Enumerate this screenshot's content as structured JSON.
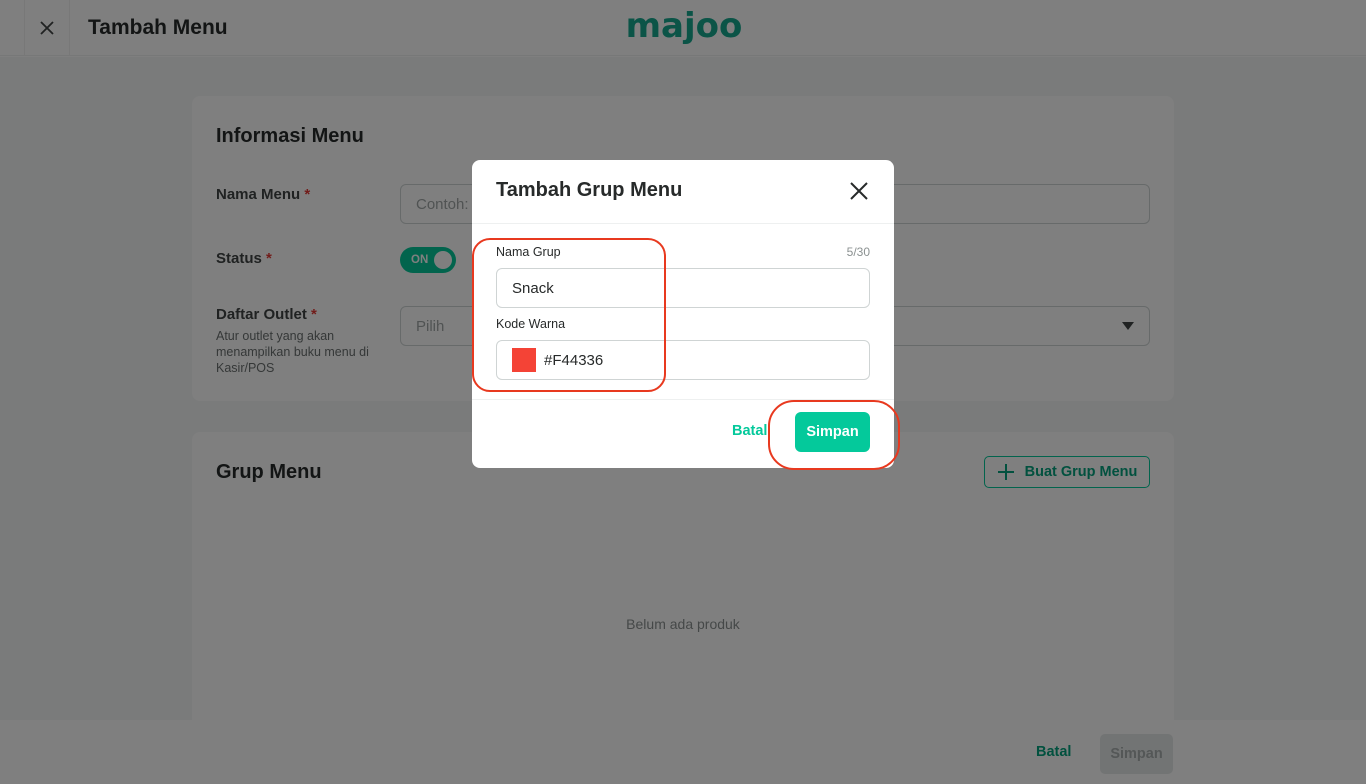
{
  "header": {
    "title": "Tambah Menu",
    "logo_text": "majoo"
  },
  "info_section": {
    "title": "Informasi Menu",
    "nama_menu_label": "Nama Menu",
    "nama_menu_placeholder": "Contoh:",
    "status_label": "Status",
    "status_toggle": "ON",
    "daftar_outlet_label": "Daftar Outlet",
    "daftar_outlet_help": "Atur outlet yang akan menampilkan buku menu di Kasir/POS",
    "outlet_placeholder": "Pilih",
    "required_mark": "*"
  },
  "grup_section": {
    "title": "Grup Menu",
    "add_button": "Buat Grup Menu",
    "empty_text": "Belum ada produk"
  },
  "footer": {
    "batal": "Batal",
    "simpan": "Simpan"
  },
  "modal": {
    "title": "Tambah Grup Menu",
    "nama_grup_label": "Nama Grup",
    "nama_grup_value": "Snack",
    "char_counter": "5/30",
    "kode_warna_label": "Kode Warna",
    "kode_warna_value": "#F44336",
    "swatch_color": "#F44336",
    "batal": "Batal",
    "simpan": "Simpan"
  },
  "colors": {
    "brand": "#04C99B",
    "highlight": "#E8391F"
  }
}
